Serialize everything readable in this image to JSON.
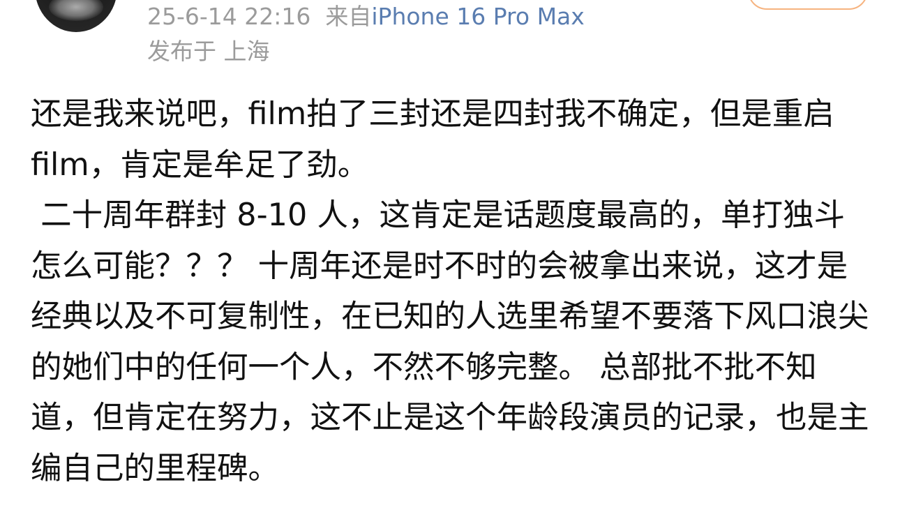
{
  "post": {
    "author_avatar": "user-avatar",
    "timestamp": "25-6-14 22:16",
    "source_prefix": "来自",
    "device": "iPhone 16 Pro Max",
    "location": "发布于 上海",
    "body": "还是我来说吧，film拍了三封还是四封我不确定，但是重启 film，肯定是牟足了劲。\n 二十周年群封 8-10 人，这肯定是话题度最高的，单打独斗怎么可能？？？ 十周年还是时不时的会被拿出来说，这才是经典以及不可复制性，在已知的人选里希望不要落下风口浪尖的她们中的任何一个人，不然不够完整。 总部批不批不知道，但肯定在努力，这不止是这个年龄段演员的记录，也是主编自己的里程碑。"
  },
  "colors": {
    "meta_text": "#9b9b9b",
    "device_link": "#5a7db0",
    "body_text": "#111111",
    "follow_border": "#f6b37f"
  }
}
